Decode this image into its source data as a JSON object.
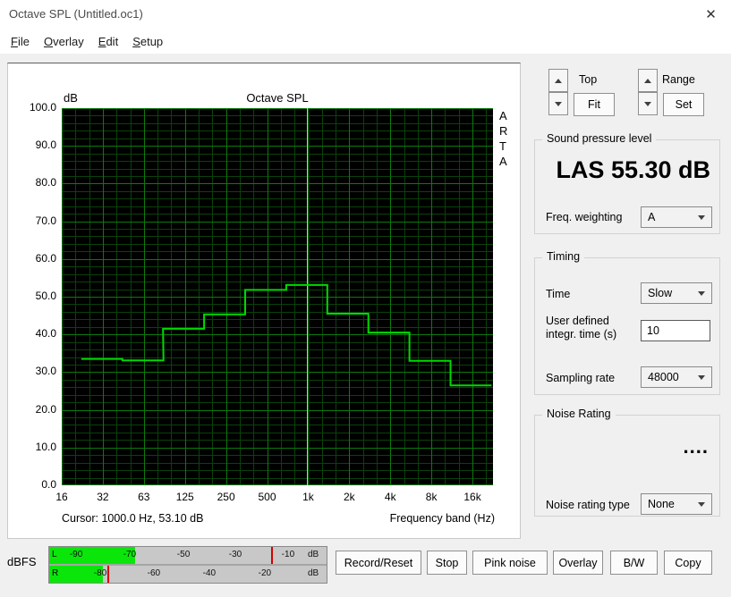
{
  "window": {
    "title": "Octave SPL (Untitled.oc1)",
    "close_icon": "✕"
  },
  "menu": [
    "File",
    "Overlay",
    "Edit",
    "Setup"
  ],
  "chart_data": {
    "type": "bar",
    "title": "Octave SPL",
    "y_unit_label": "dB",
    "xlabel": "Frequency band (Hz)",
    "ylim": [
      0,
      100
    ],
    "y_major_step": 10,
    "y_minor_step": 2,
    "x_start_hz": 16,
    "x_octaves": 10.5,
    "x_tick_labels": [
      "16",
      "32",
      "63",
      "125",
      "250",
      "500",
      "1k",
      "2k",
      "4k",
      "8k",
      "16k"
    ],
    "band_centers_hz": [
      31.5,
      63,
      125,
      250,
      500,
      1000,
      2000,
      4000,
      8000,
      16000
    ],
    "band_levels_db": [
      33.5,
      33.1,
      41.5,
      45.3,
      51.8,
      53.1,
      45.5,
      40.5,
      33.0,
      26.5
    ],
    "cursor": {
      "freq_hz": 1000,
      "level_db": 53.1,
      "text": "Cursor: 1000.0 Hz, 53.10 dB"
    },
    "side_label": "ARTA",
    "legend": [],
    "grid": true,
    "colors": {
      "bg": "#000000",
      "grid_major": "#0c7a0c",
      "grid_minor": "#0a420a",
      "trace": "#00d900",
      "cursor_line": "#c4c4c4"
    }
  },
  "right_panel": {
    "top_control": {
      "label": "Top",
      "button": "Fit"
    },
    "range_control": {
      "label": "Range",
      "button": "Set"
    },
    "spl_group": {
      "title": "Sound pressure level",
      "value": "LAS 55.30 dB",
      "weighting_label": "Freq. weighting",
      "weighting_value": "A"
    },
    "timing_group": {
      "title": "Timing",
      "time_label": "Time",
      "time_value": "Slow",
      "integr_label_line1": "User defined",
      "integr_label_line2": "integr. time (s)",
      "integr_value": "10",
      "sampling_label": "Sampling rate",
      "sampling_value": "48000"
    },
    "noise_group": {
      "title": "Noise Rating",
      "value_display": "....",
      "type_label": "Noise rating type",
      "type_value": "None"
    }
  },
  "meter": {
    "label": "dBFS",
    "channels": [
      {
        "name": "L",
        "level_pct": 31,
        "peak_pct": 80,
        "ticks": [
          {
            "t": "-90",
            "p": 9.7
          },
          {
            "t": "-70",
            "p": 29
          },
          {
            "t": "-50",
            "p": 48.4
          },
          {
            "t": "-30",
            "p": 67.1
          },
          {
            "t": "-10",
            "p": 86.1
          },
          {
            "t": "dB",
            "p": 95.2
          }
        ]
      },
      {
        "name": "R",
        "level_pct": 19.5,
        "peak_pct": 21,
        "ticks": [
          {
            "t": "-80",
            "p": 18.4
          },
          {
            "t": "-60",
            "p": 37.7
          },
          {
            "t": "-40",
            "p": 57.7
          },
          {
            "t": "-20",
            "p": 77.7
          },
          {
            "t": "dB",
            "p": 95.2
          }
        ]
      }
    ]
  },
  "bottom_buttons": [
    "Record/Reset",
    "Stop",
    "Pink noise",
    "Overlay",
    "B/W",
    "Copy"
  ]
}
